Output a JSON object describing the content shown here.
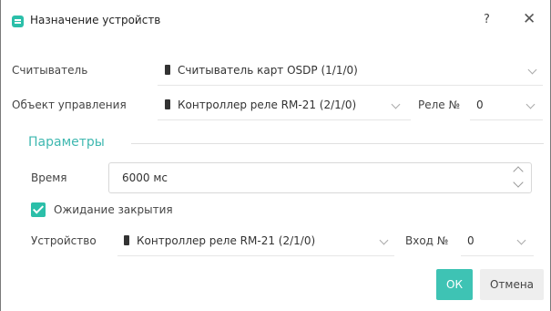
{
  "dialog": {
    "title": "Назначение устройств",
    "help": "?",
    "close": "✕"
  },
  "reader": {
    "label": "Считыватель",
    "value": "Считыватель карт OSDP (1/1/0)"
  },
  "control_object": {
    "label": "Объект управления",
    "value": "Контроллер реле RM-21 (2/1/0)",
    "relay_label": "Реле №",
    "relay_value": "0"
  },
  "params": {
    "title": "Параметры",
    "time_label": "Время",
    "time_value": "6000 мс",
    "wait_close_label": "Ожидание закрытия",
    "wait_close_checked": true,
    "device_label": "Устройство",
    "device_value": "Контроллер реле RM-21 (2/1/0)",
    "input_label": "Вход №",
    "input_value": "0"
  },
  "buttons": {
    "ok": "ОК",
    "cancel": "Отмена"
  },
  "colors": {
    "accent": "#3ec3b4",
    "section_title": "#3fb8b0"
  }
}
